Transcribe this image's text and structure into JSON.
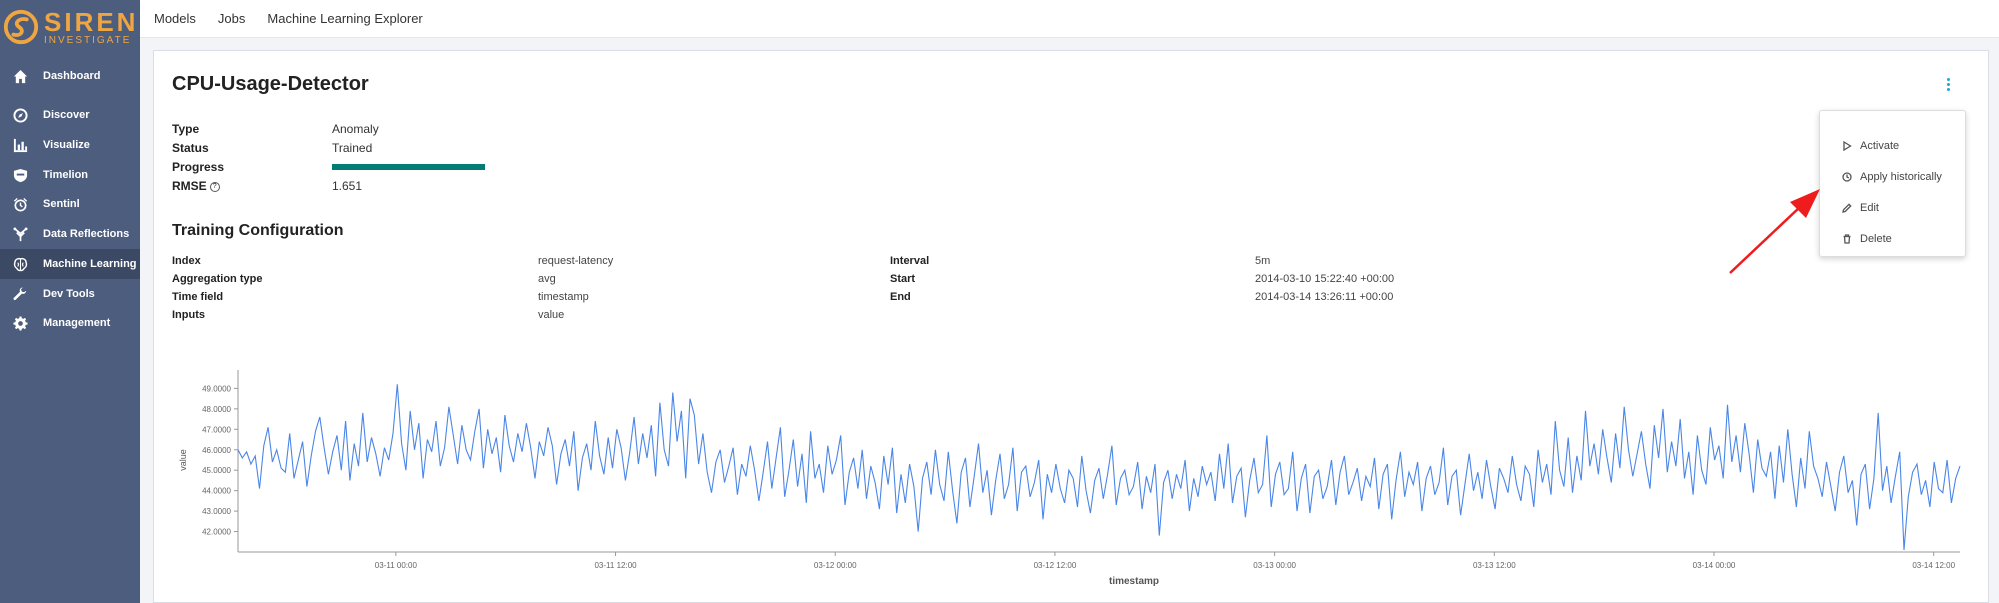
{
  "app": {
    "logo_title": "SIREN",
    "logo_subtitle": "INVESTIGATE",
    "brand_color": "#f0a640"
  },
  "sidebar": {
    "items": [
      {
        "label": "Dashboard",
        "icon": "home-icon"
      },
      {
        "label": "Discover",
        "icon": "compass-icon"
      },
      {
        "label": "Visualize",
        "icon": "bar-chart-icon"
      },
      {
        "label": "Timelion",
        "icon": "shield-icon"
      },
      {
        "label": "Sentinl",
        "icon": "alarm-clock-icon"
      },
      {
        "label": "Data Reflections",
        "icon": "reflection-icon"
      },
      {
        "label": "Machine Learning",
        "icon": "brain-icon",
        "active": true
      },
      {
        "label": "Dev Tools",
        "icon": "wrench-icon"
      },
      {
        "label": "Management",
        "icon": "gear-icon"
      }
    ]
  },
  "topnav": {
    "tabs": [
      "Models",
      "Jobs",
      "Machine Learning Explorer"
    ]
  },
  "model": {
    "title": "CPU-Usage-Detector",
    "type_label": "Type",
    "type_value": "Anomaly",
    "status_label": "Status",
    "status_value": "Trained",
    "progress_label": "Progress",
    "progress_fraction": 1.0,
    "progress_color": "#017d73",
    "rmse_label": "RMSE",
    "rmse_value": "1.651"
  },
  "training": {
    "section_title": "Training Configuration",
    "left": [
      {
        "label": "Index",
        "value": "request-latency"
      },
      {
        "label": "Aggregation type",
        "value": "avg"
      },
      {
        "label": "Time field",
        "value": "timestamp"
      },
      {
        "label": "Inputs",
        "value": "value"
      }
    ],
    "right": [
      {
        "label": "Interval",
        "value": "5m"
      },
      {
        "label": "Start",
        "value": "2014-03-10 15:22:40 +00:00"
      },
      {
        "label": "End",
        "value": "2014-03-14 13:26:11 +00:00"
      }
    ]
  },
  "menu": {
    "items": [
      {
        "label": "Activate",
        "icon": "play-icon"
      },
      {
        "label": "Apply historically",
        "icon": "clock-icon"
      },
      {
        "label": "Edit",
        "icon": "pencil-icon"
      },
      {
        "label": "Delete",
        "icon": "trash-icon"
      }
    ]
  },
  "chart_data": {
    "type": "line",
    "xlabel": "timestamp",
    "ylabel": "value",
    "line_color": "#4a86e8",
    "ylim": [
      41.0,
      49.9
    ],
    "yticks": [
      "42.0000",
      "43.0000",
      "44.0000",
      "45.0000",
      "46.0000",
      "47.0000",
      "48.0000",
      "49.0000"
    ],
    "xticks": [
      "03-11 00:00",
      "03-11 12:00",
      "03-12 00:00",
      "03-12 12:00",
      "03-13 00:00",
      "03-13 12:00",
      "03-14 00:00",
      "03-14 12:00"
    ],
    "x_start": "2014-03-10 15:22:40",
    "x_end": "2014-03-14 13:26:11",
    "series": [
      {
        "values": [
          46.0,
          45.6,
          45.9,
          45.3,
          45.7,
          44.1,
          46.2,
          47.1,
          45.4,
          46.0,
          45.1,
          44.9,
          46.8,
          44.6,
          45.5,
          46.4,
          44.2,
          45.7,
          46.9,
          47.6,
          46.1,
          44.8,
          45.9,
          46.7,
          45.0,
          47.4,
          44.5,
          46.3,
          45.2,
          47.8,
          45.4,
          46.6,
          45.8,
          44.7,
          46.1,
          45.5,
          46.8,
          49.2,
          46.3,
          45.0,
          47.9,
          46.0,
          47.3,
          44.6,
          46.5,
          45.9,
          47.4,
          45.2,
          46.1,
          48.1,
          46.7,
          45.3,
          47.2,
          46.0,
          45.5,
          46.9,
          48.0,
          45.1,
          47.0,
          45.8,
          46.6,
          44.9,
          47.7,
          46.2,
          45.4,
          46.8,
          45.9,
          47.3,
          46.1,
          44.6,
          46.4,
          45.7,
          47.1,
          46.2,
          44.3,
          45.8,
          46.5,
          45.2,
          46.9,
          44.0,
          45.6,
          46.3,
          45.0,
          47.4,
          45.7,
          44.8,
          46.6,
          45.1,
          47.0,
          46.1,
          44.5,
          45.9,
          47.6,
          45.3,
          46.8,
          45.6,
          47.2,
          44.7,
          48.3,
          46.0,
          45.2,
          48.8,
          46.4,
          47.9,
          44.6,
          48.5,
          47.7,
          45.3,
          46.8,
          44.9,
          43.9,
          45.4,
          46.0,
          44.4,
          45.2,
          46.1,
          43.8,
          45.3,
          44.7,
          46.2,
          45.0,
          43.5,
          44.9,
          46.4,
          44.1,
          45.6,
          47.1,
          43.7,
          45.0,
          46.5,
          44.2,
          45.8,
          43.4,
          46.9,
          44.6,
          45.3,
          43.9,
          46.2,
          44.8,
          45.5,
          46.7,
          43.3,
          44.9,
          45.6,
          44.1,
          46.0,
          43.6,
          45.2,
          44.4,
          43.1,
          45.7,
          44.3,
          46.1,
          42.9,
          44.8,
          43.4,
          45.3,
          44.2,
          42.0,
          44.6,
          45.4,
          43.8,
          46.0,
          44.3,
          43.5,
          45.9,
          44.0,
          42.4,
          44.9,
          45.6,
          43.2,
          44.7,
          46.3,
          43.9,
          45.0,
          42.8,
          44.5,
          45.8,
          43.6,
          44.3,
          46.1,
          43.0,
          44.9,
          45.2,
          43.7,
          44.4,
          45.5,
          42.6,
          44.8,
          43.9,
          45.3,
          44.1,
          43.4,
          45.0,
          44.6,
          43.2,
          45.7,
          44.0,
          42.9,
          44.5,
          45.1,
          43.6,
          44.8,
          46.2,
          43.3,
          44.6,
          45.0,
          43.8,
          44.2,
          45.4,
          43.1,
          44.7,
          43.9,
          45.3,
          41.8,
          44.4,
          45.0,
          43.6,
          44.8,
          44.1,
          45.5,
          43.0,
          44.6,
          43.7,
          45.2,
          44.3,
          44.9,
          43.5,
          45.8,
          44.1,
          46.3,
          43.4,
          44.7,
          45.1,
          42.7,
          44.5,
          45.6,
          43.9,
          44.3,
          46.7,
          43.2,
          44.8,
          45.4,
          43.8,
          44.1,
          45.9,
          43.0,
          44.6,
          45.3,
          42.9,
          44.7,
          45.0,
          43.6,
          44.2,
          45.5,
          43.3,
          44.9,
          45.7,
          43.8,
          44.4,
          45.1,
          43.5,
          44.7,
          44.2,
          45.6,
          43.1,
          44.8,
          45.3,
          42.6,
          44.5,
          45.9,
          43.7,
          44.9,
          44.3,
          45.4,
          43.0,
          44.6,
          45.2,
          43.8,
          44.4,
          46.1,
          43.3,
          44.7,
          45.0,
          42.8,
          44.3,
          45.8,
          44.0,
          44.9,
          43.6,
          45.5,
          44.2,
          43.1,
          45.1,
          44.6,
          43.9,
          45.7,
          44.3,
          43.5,
          45.2,
          44.8,
          43.2,
          46.0,
          44.4,
          45.3,
          43.8,
          47.4,
          45.0,
          44.2,
          46.6,
          43.9,
          45.7,
          44.5,
          47.9,
          45.2,
          46.3,
          44.8,
          47.0,
          45.6,
          44.4,
          46.8,
          45.1,
          48.1,
          46.0,
          44.7,
          45.8,
          46.9,
          45.3,
          44.1,
          47.2,
          45.6,
          48.0,
          44.9,
          46.4,
          45.2,
          47.5,
          44.6,
          45.9,
          43.8,
          46.7,
          45.0,
          44.3,
          47.1,
          45.5,
          46.2,
          44.6,
          48.2,
          45.4,
          46.7,
          44.9,
          47.3,
          45.8,
          43.9,
          46.5,
          45.1,
          44.7,
          45.9,
          43.6,
          46.2,
          44.4,
          47.0,
          44.8,
          43.2,
          45.6,
          44.1,
          46.9,
          45.2,
          44.6,
          43.7,
          45.4,
          44.2,
          43.0,
          44.9,
          45.7,
          43.9,
          44.5,
          42.3,
          44.8,
          45.3,
          43.1,
          44.6,
          47.8,
          44.0,
          45.2,
          43.4,
          44.7,
          45.9,
          41.1,
          43.7,
          44.9,
          45.3,
          43.8,
          44.5,
          43.2,
          45.4,
          44.1,
          43.9,
          45.5,
          43.4,
          44.6,
          45.2
        ]
      }
    ]
  }
}
